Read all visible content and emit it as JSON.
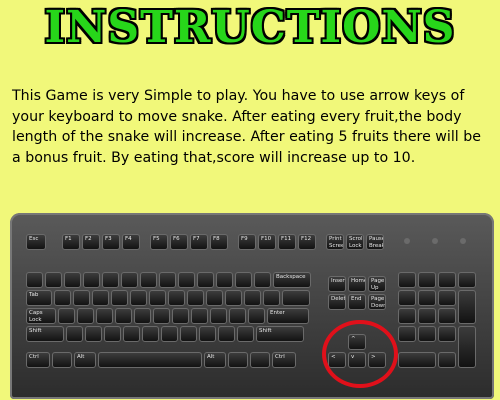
{
  "title": "INSTRUCTIONS",
  "instructions": "This Game is very Simple to play. You have to use arrow keys of your keyboard to move snake. After eating every fruit,the body length of the snake will increase. After eating 5 fruits there will be a bonus fruit. By eating that,score will increase up to 10.",
  "keyboard": {
    "esc": "Esc",
    "f_keys": [
      "F1",
      "F2",
      "F3",
      "F4",
      "F5",
      "F6",
      "F7",
      "F8",
      "F9",
      "F10",
      "F11",
      "F12"
    ],
    "prt": "Print Screen",
    "scroll": "Scroll Lock",
    "pause": "Pause Break",
    "backspace": "Backspace",
    "tab": "Tab",
    "caps": "Caps Lock",
    "enter": "Enter",
    "shift": "Shift",
    "ctrl": "Ctrl",
    "alt": "Alt",
    "insert": "Insert",
    "home": "Home",
    "pgup": "Page Up",
    "delete": "Delete",
    "end": "End",
    "pgdn": "Page Down",
    "arrow_up": "^",
    "arrow_left": "<",
    "arrow_down": "v",
    "arrow_right": ">"
  },
  "colors": {
    "background": "#f1f87a",
    "title": "#27d61a",
    "highlight": "#e0101a"
  }
}
